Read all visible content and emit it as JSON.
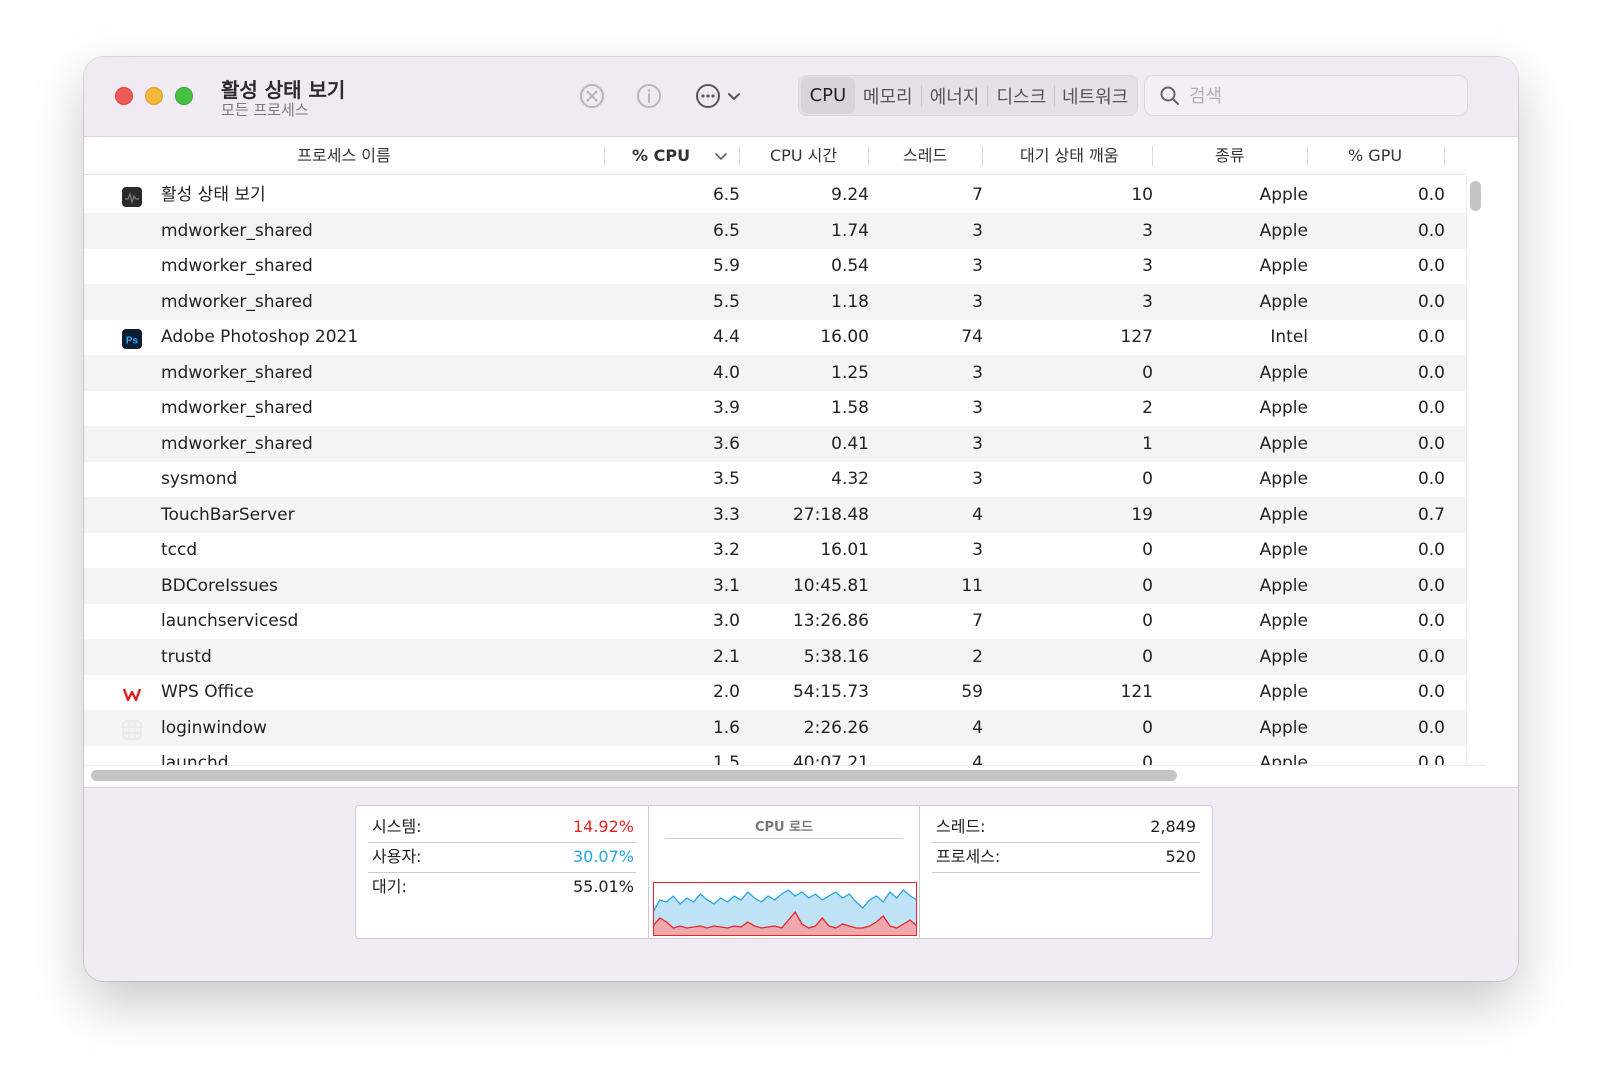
{
  "window": {
    "title": "활성 상태 보기",
    "subtitle": "모든 프로세스"
  },
  "toolbar": {
    "icons": [
      "stop-process-icon",
      "info-icon",
      "more-actions-icon",
      "chevron-down-icon"
    ],
    "tabs": [
      {
        "label": "CPU",
        "active": true
      },
      {
        "label": "메모리",
        "active": false
      },
      {
        "label": "에너지",
        "active": false
      },
      {
        "label": "디스크",
        "active": false
      },
      {
        "label": "네트워크",
        "active": false
      }
    ],
    "search": {
      "placeholder": "검색",
      "value": ""
    }
  },
  "columns": {
    "name": "프로세스 이름",
    "cpu": "% CPU",
    "cpu_time": "CPU 시간",
    "threads": "스레드",
    "idle_wake": "대기 상태 깨움",
    "kind": "종류",
    "gpu": "% GPU"
  },
  "processes": [
    {
      "icon": "activity-monitor-icon",
      "name": "활성 상태 보기",
      "cpu": "6.5",
      "time": "9.24",
      "threads": "7",
      "wake": "10",
      "kind": "Apple",
      "gpu": "0.0"
    },
    {
      "icon": "",
      "name": "mdworker_shared",
      "cpu": "6.5",
      "time": "1.74",
      "threads": "3",
      "wake": "3",
      "kind": "Apple",
      "gpu": "0.0"
    },
    {
      "icon": "",
      "name": "mdworker_shared",
      "cpu": "5.9",
      "time": "0.54",
      "threads": "3",
      "wake": "3",
      "kind": "Apple",
      "gpu": "0.0"
    },
    {
      "icon": "",
      "name": "mdworker_shared",
      "cpu": "5.5",
      "time": "1.18",
      "threads": "3",
      "wake": "3",
      "kind": "Apple",
      "gpu": "0.0"
    },
    {
      "icon": "photoshop-icon",
      "name": "Adobe Photoshop 2021",
      "cpu": "4.4",
      "time": "16.00",
      "threads": "74",
      "wake": "127",
      "kind": "Intel",
      "gpu": "0.0"
    },
    {
      "icon": "",
      "name": "mdworker_shared",
      "cpu": "4.0",
      "time": "1.25",
      "threads": "3",
      "wake": "0",
      "kind": "Apple",
      "gpu": "0.0"
    },
    {
      "icon": "",
      "name": "mdworker_shared",
      "cpu": "3.9",
      "time": "1.58",
      "threads": "3",
      "wake": "2",
      "kind": "Apple",
      "gpu": "0.0"
    },
    {
      "icon": "",
      "name": "mdworker_shared",
      "cpu": "3.6",
      "time": "0.41",
      "threads": "3",
      "wake": "1",
      "kind": "Apple",
      "gpu": "0.0"
    },
    {
      "icon": "",
      "name": "sysmond",
      "cpu": "3.5",
      "time": "4.32",
      "threads": "3",
      "wake": "0",
      "kind": "Apple",
      "gpu": "0.0"
    },
    {
      "icon": "",
      "name": "TouchBarServer",
      "cpu": "3.3",
      "time": "27:18.48",
      "threads": "4",
      "wake": "19",
      "kind": "Apple",
      "gpu": "0.7"
    },
    {
      "icon": "",
      "name": "tccd",
      "cpu": "3.2",
      "time": "16.01",
      "threads": "3",
      "wake": "0",
      "kind": "Apple",
      "gpu": "0.0"
    },
    {
      "icon": "",
      "name": "BDCoreIssues",
      "cpu": "3.1",
      "time": "10:45.81",
      "threads": "11",
      "wake": "0",
      "kind": "Apple",
      "gpu": "0.0"
    },
    {
      "icon": "",
      "name": "launchservicesd",
      "cpu": "3.0",
      "time": "13:26.86",
      "threads": "7",
      "wake": "0",
      "kind": "Apple",
      "gpu": "0.0"
    },
    {
      "icon": "",
      "name": "trustd",
      "cpu": "2.1",
      "time": "5:38.16",
      "threads": "2",
      "wake": "0",
      "kind": "Apple",
      "gpu": "0.0"
    },
    {
      "icon": "wps-office-icon",
      "name": "WPS Office",
      "cpu": "2.0",
      "time": "54:15.73",
      "threads": "59",
      "wake": "121",
      "kind": "Apple",
      "gpu": "0.0"
    },
    {
      "icon": "loginwindow-icon",
      "name": "loginwindow",
      "cpu": "1.6",
      "time": "2:26.26",
      "threads": "4",
      "wake": "0",
      "kind": "Apple",
      "gpu": "0.0"
    },
    {
      "icon": "",
      "name": "launchd",
      "cpu": "1.5",
      "time": "40:07.21",
      "threads": "4",
      "wake": "0",
      "kind": "Apple",
      "gpu": "0.0"
    }
  ],
  "summary": {
    "system_label": "시스템:",
    "system_value": "14.92%",
    "user_label": "사용자:",
    "user_value": "30.07%",
    "idle_label": "대기:",
    "idle_value": "55.01%",
    "graph_title": "CPU 로드",
    "threads_label": "스레드:",
    "threads_value": "2,849",
    "processes_label": "프로세스:",
    "processes_value": "520"
  },
  "colors": {
    "system": "#e8242b",
    "user": "#27a3e6",
    "user_fill": "#bfe2f7",
    "system_fill": "#f0a8ad"
  }
}
